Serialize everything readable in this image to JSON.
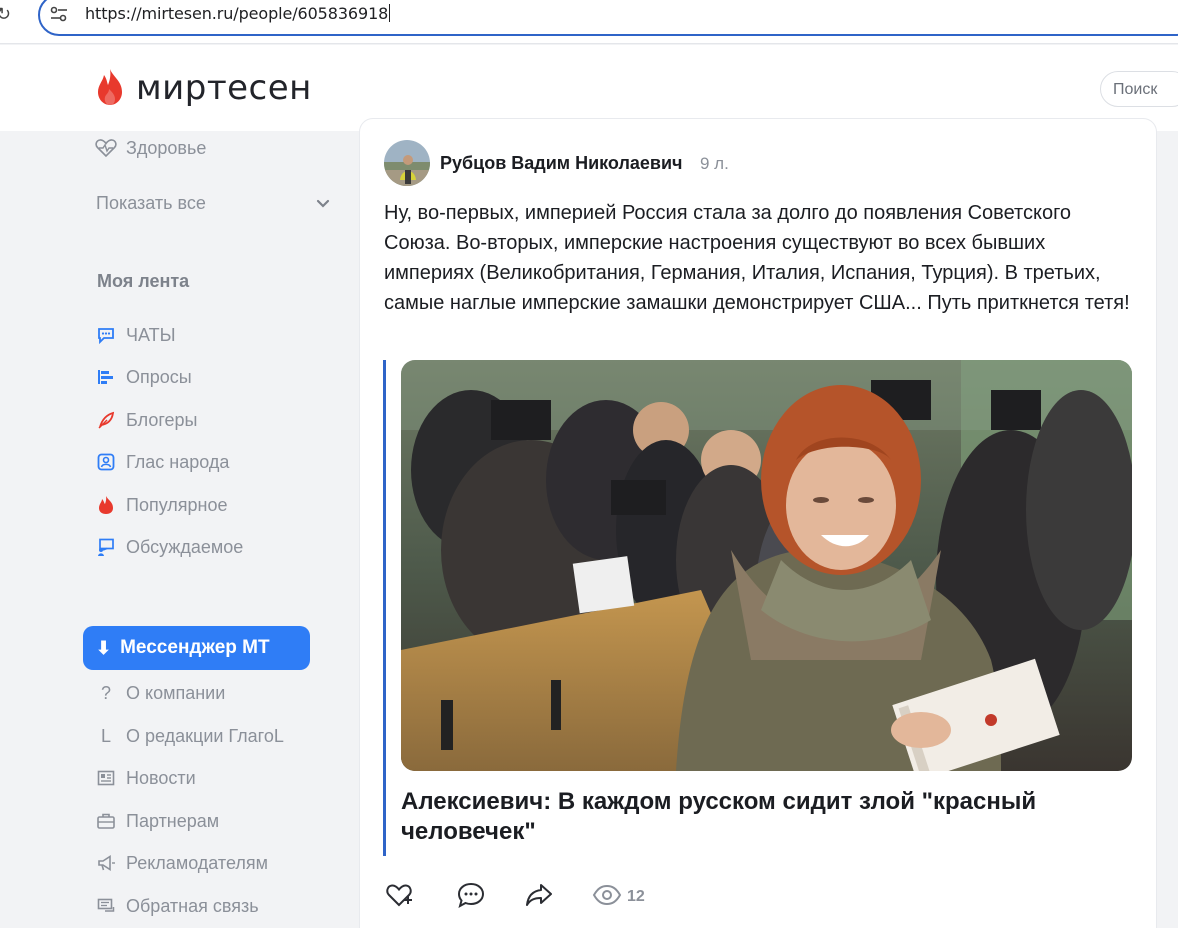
{
  "browser": {
    "url": "https://mirtesen.ru/people/605836918"
  },
  "header": {
    "logo_text": "миртесен",
    "search_placeholder": "Поиск"
  },
  "sidebar": {
    "health_label": "Здоровье",
    "show_all_label": "Показать все",
    "feed_heading": "Моя лента",
    "feed_items": [
      {
        "label": "ЧАТЫ",
        "icon": "chat-icon"
      },
      {
        "label": "Опросы",
        "icon": "poll-icon"
      },
      {
        "label": "Блогеры",
        "icon": "feather-icon"
      },
      {
        "label": "Глас народа",
        "icon": "megaphone-badge-icon"
      },
      {
        "label": "Популярное",
        "icon": "flame-icon"
      },
      {
        "label": "Обсуждаемое",
        "icon": "discussion-icon"
      }
    ],
    "messenger_label": "Мессенджер МТ",
    "footer_items": [
      {
        "label": "О компании",
        "icon": "question-icon"
      },
      {
        "label": "О редакции ГлагоL",
        "icon": "letter-l-icon"
      },
      {
        "label": "Новости",
        "icon": "news-icon"
      },
      {
        "label": "Партнерам",
        "icon": "briefcase-icon"
      },
      {
        "label": "Рекламодателям",
        "icon": "loudspeaker-icon"
      },
      {
        "label": "Обратная связь",
        "icon": "feedback-icon"
      }
    ]
  },
  "post": {
    "author": "Рубцов Вадим Николаевич",
    "age": "9 л.",
    "text": "Ну, во-первых, империей Россия стала за долго до появления Советского Союза. Во-вторых, имперские настроения существуют во всех бывших империях (Великобритания, Германия, Италия, Испания, Турция). В третьих, самые наглые имперские замашки демонстрирует США... Путь приткнется тетя!",
    "article_title": "Алексиевич: В каждом русском сидит злой \"красный человечек\"",
    "views": "12"
  },
  "colors": {
    "accent": "#2f7df6",
    "brand_red": "#e8392d",
    "quote_bar": "#2f64c8",
    "muted_text": "#8b9099"
  }
}
